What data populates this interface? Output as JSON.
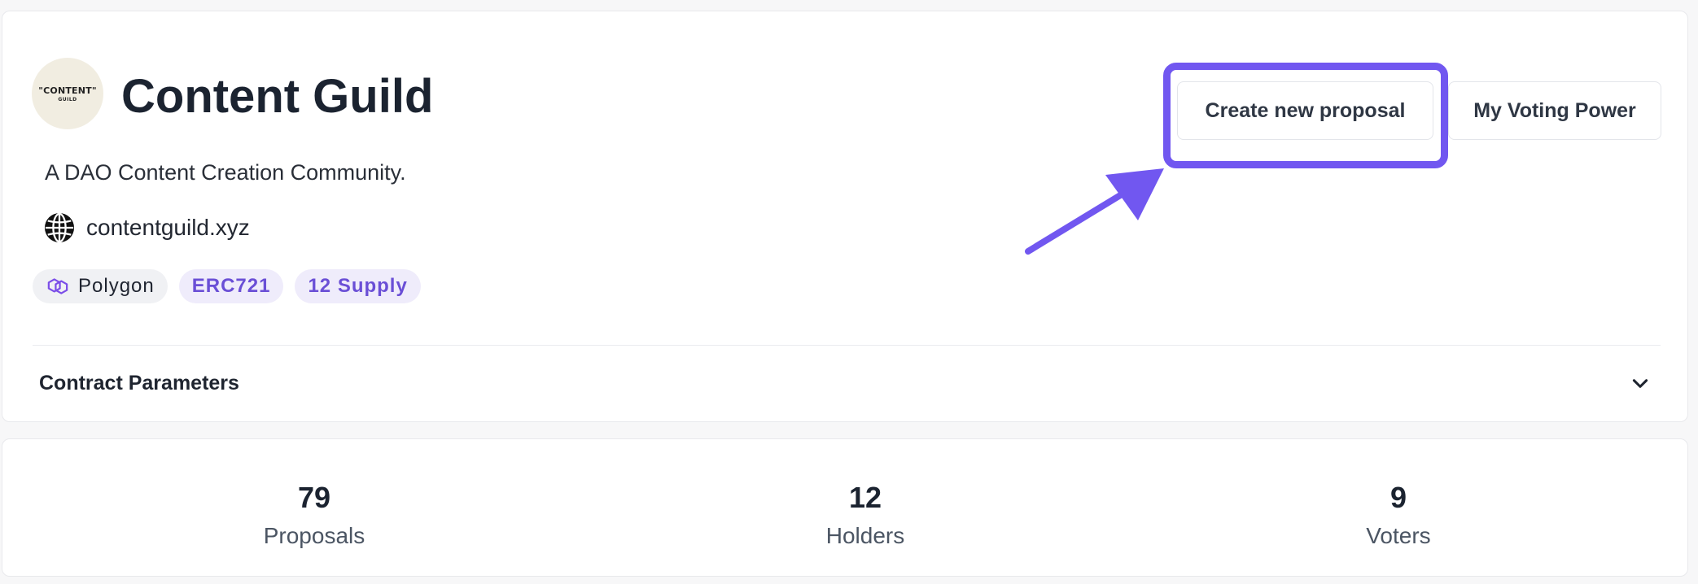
{
  "header": {
    "logo": {
      "line1": "\"CONTENT\"",
      "line2": "GUILD"
    },
    "title": "Content Guild",
    "description": "A DAO Content Creation Community.",
    "website": {
      "icon": "globe-icon",
      "url": "contentguild.xyz"
    }
  },
  "tags": {
    "chain": {
      "label": "Polygon",
      "icon": "polygon-icon"
    },
    "standard": "ERC721",
    "supply": "12 Supply"
  },
  "actions": {
    "create_proposal": "Create new proposal",
    "voting_power": "My Voting Power"
  },
  "contract_parameters": {
    "label": "Contract Parameters",
    "icon": "chevron-down-icon"
  },
  "stats": [
    {
      "value": "79",
      "label": "Proposals"
    },
    {
      "value": "12",
      "label": "Holders"
    },
    {
      "value": "9",
      "label": "Voters"
    }
  ],
  "colors": {
    "accent": "#7157f0",
    "tag_text": "#6a4fd6",
    "tag_bg": "#efecfb",
    "title": "#1b2330"
  }
}
